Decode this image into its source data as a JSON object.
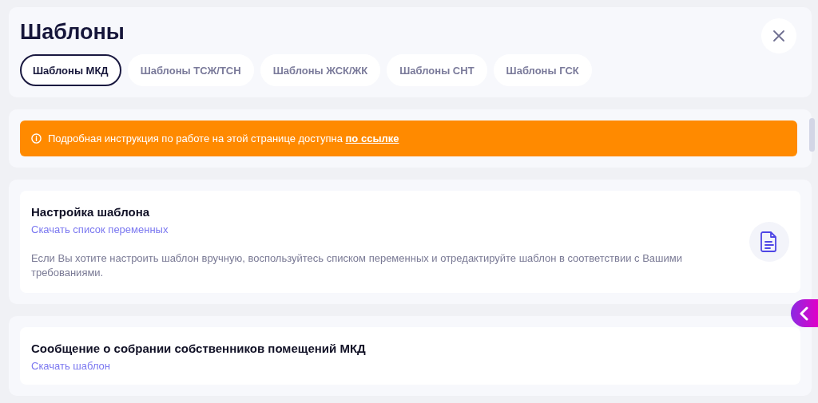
{
  "header": {
    "title": "Шаблоны"
  },
  "tabs": [
    {
      "label": "Шаблоны МКД",
      "selected": true
    },
    {
      "label": "Шаблоны ТСЖ/ТСН",
      "selected": false
    },
    {
      "label": "Шаблоны ЖСК/ЖК",
      "selected": false
    },
    {
      "label": "Шаблоны СНТ",
      "selected": false
    },
    {
      "label": "Шаблоны ГСК",
      "selected": false
    }
  ],
  "notice": {
    "text": "Подробная инструкция по работе на этой странице доступна",
    "link": "по ссылке"
  },
  "cards": [
    {
      "title": "Настройка шаблона",
      "link": "Скачать список переменных",
      "description": "Если Вы хотите настроить шаблон вручную, воспользуйтесь списком переменных и отредактируйте шаблон в соответствии с Вашими требованиями."
    },
    {
      "title": "Сообщение о собрании собственников помещений МКД",
      "link": "Скачать шаблон"
    }
  ]
}
